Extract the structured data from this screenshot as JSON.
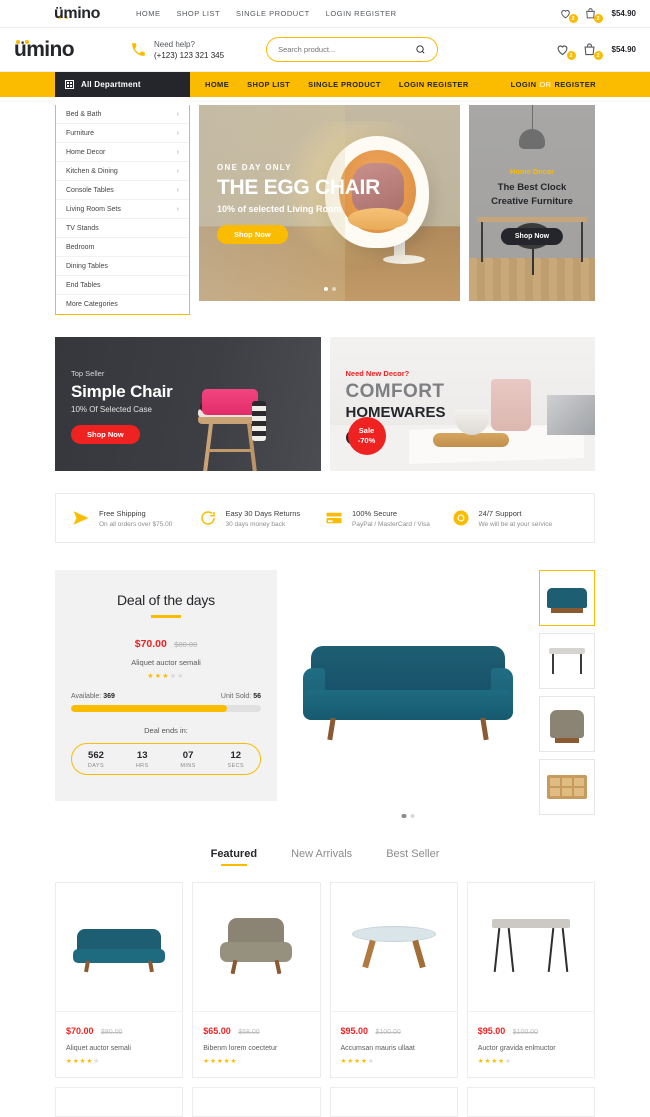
{
  "brand": {
    "name": "ümino"
  },
  "topbar": {
    "nav": [
      {
        "label": "HOME"
      },
      {
        "label": "SHOP LIST"
      },
      {
        "label": "SINGLE PRODUCT"
      },
      {
        "label": "LOGIN REGISTER"
      }
    ],
    "wishlist_count": "2",
    "cart_count": "2",
    "cart_total": "$54.90"
  },
  "header": {
    "help_label": "Need help?",
    "phone": "(+123) 123 321 345",
    "search_placeholder": "Search product...",
    "wishlist_count": "2",
    "cart_count": "2",
    "cart_total": "$54.90"
  },
  "nav": {
    "all_department": "All Department",
    "links": [
      {
        "label": "HOME"
      },
      {
        "label": "SHOP LIST"
      },
      {
        "label": "SINGLE PRODUCT"
      },
      {
        "label": "LOGIN REGISTER"
      }
    ],
    "auth_login": "LOGIN",
    "auth_or": "OR",
    "auth_register": "REGISTER"
  },
  "sidebar": {
    "items": [
      {
        "label": "Bed & Bath",
        "chevron": "›"
      },
      {
        "label": "Furniture",
        "chevron": "›"
      },
      {
        "label": "Home Decor",
        "chevron": "›"
      },
      {
        "label": "Kitchen & Dining",
        "chevron": "›"
      },
      {
        "label": "Console Tables",
        "chevron": "›"
      },
      {
        "label": "Living Room Sets",
        "chevron": "›"
      },
      {
        "label": "TV Stands",
        "chevron": ""
      },
      {
        "label": "Bedroom",
        "chevron": ""
      },
      {
        "label": "Dining Tables",
        "chevron": ""
      },
      {
        "label": "End Tables",
        "chevron": ""
      },
      {
        "label": "More Categories",
        "chevron": ""
      }
    ]
  },
  "hero": {
    "kicker": "ONE DAY ONLY",
    "heading": "THE EGG CHAIR",
    "subheading": "10% of selected Living Room",
    "button": "Shop Now"
  },
  "side_banner": {
    "kicker": "Home Decor",
    "line1": "The Best Clock",
    "line2": "Creative Furniture",
    "button": "Shop Now"
  },
  "promos": [
    {
      "kicker": "Top Seller",
      "heading": "Simple Chair",
      "sub": "10% Of Selected Case",
      "button": "Shop Now"
    },
    {
      "kicker": "Need New Decor?",
      "heading": "COMFORT",
      "heading2": "HOMEWARES",
      "arrow": "➔",
      "sale_line1": "Sale",
      "sale_line2": "-70%"
    }
  ],
  "services": [
    {
      "icon": "paper-plane-icon",
      "title": "Free Shipping",
      "sub": "On all orders over $75.00"
    },
    {
      "icon": "refresh-icon",
      "title": "Easy 30 Days Returns",
      "sub": "30 days money back"
    },
    {
      "icon": "credit-card-icon",
      "title": "100% Secure",
      "sub": "PayPal / MasterCard / Visa"
    },
    {
      "icon": "lifebuoy-icon",
      "title": "24/7 Support",
      "sub": "We will be at your service"
    }
  ],
  "deal": {
    "title": "Deal of the days",
    "price": "$70.00",
    "old_price": "$80.00",
    "name": "Aliquet auctor semali",
    "rating": 3,
    "available_label": "Available:",
    "available_value": "369",
    "sold_label": "Unit Sold:",
    "sold_value": "56",
    "progress_percent": 82,
    "ends_label": "Deal ends in:",
    "timer": [
      {
        "num": "562",
        "label": "DAYS"
      },
      {
        "num": "13",
        "label": "HRS"
      },
      {
        "num": "07",
        "label": "MINS"
      },
      {
        "num": "12",
        "label": "SECS"
      }
    ],
    "thumbs": [
      {
        "name": "sofa-thumb",
        "selected": true
      },
      {
        "name": "table-thumb",
        "selected": false
      },
      {
        "name": "armchair-thumb",
        "selected": false
      },
      {
        "name": "cabinet-thumb",
        "selected": false
      }
    ]
  },
  "tabs": [
    {
      "label": "Featured",
      "active": true
    },
    {
      "label": "New Arrivals",
      "active": false
    },
    {
      "label": "Best Seller",
      "active": false
    }
  ],
  "products": [
    {
      "price": "$70.00",
      "old_price": "$80.00",
      "name": "Aliquet auctor semali",
      "rating": 3.5,
      "image": "blue-sofa"
    },
    {
      "price": "$65.00",
      "old_price": "$68.00",
      "name": "Bibenm lorem coectetur",
      "rating": 4.5,
      "image": "grey-armchair"
    },
    {
      "price": "$95.00",
      "old_price": "$100.00",
      "name": "Accumsan mauris ullaat",
      "rating": 3.5,
      "image": "glass-coffee-table"
    },
    {
      "price": "$95.00",
      "old_price": "$100.00",
      "name": "Auctor gravida enlmuctor",
      "rating": 4,
      "image": "hairpin-side-table"
    }
  ],
  "colors": {
    "accent": "#fbbc00",
    "dark": "#24262b",
    "red": "#ef2222",
    "teal": "#1d5e72"
  }
}
